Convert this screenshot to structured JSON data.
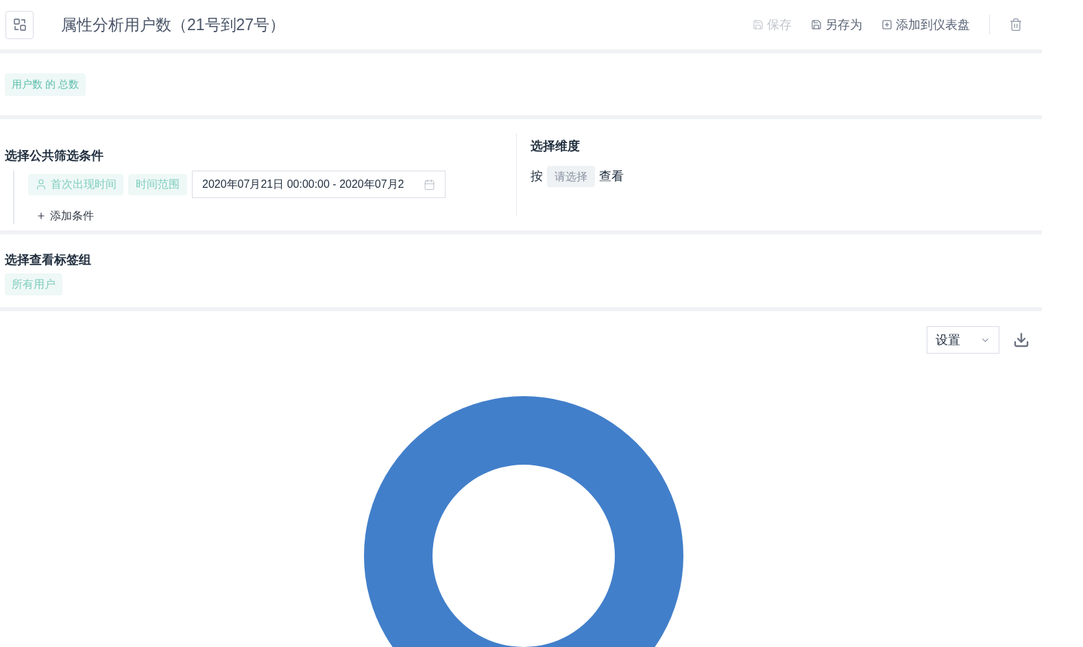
{
  "header": {
    "title": "属性分析用户数（21号到27号）",
    "actions": [
      {
        "kind": "save",
        "label": "保存",
        "disabled": true
      },
      {
        "kind": "save_as",
        "label": "另存为",
        "disabled": false
      },
      {
        "kind": "add",
        "label": "添加到仪表盘",
        "disabled": false
      }
    ]
  },
  "metric": {
    "tag": "用户数 的 总数"
  },
  "filters": {
    "title": "选择公共筛选条件",
    "condition": {
      "property": "首次出现时间",
      "operator": "时间范围",
      "value": "2020年07月21日 00:00:00 - 2020年07月2"
    },
    "add_label": "添加条件"
  },
  "dimension": {
    "title": "选择维度",
    "prefix": "按",
    "placeholder": "请选择",
    "suffix": "查看"
  },
  "tag_group": {
    "title": "选择查看标签组",
    "tag": "所有用户"
  },
  "chart": {
    "settings_label": "设置"
  }
}
